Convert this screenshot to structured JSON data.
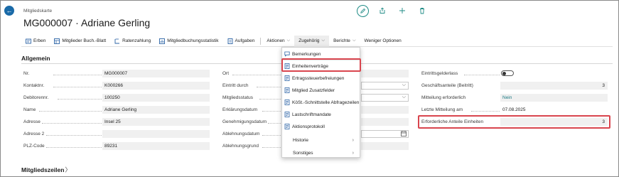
{
  "header": {
    "caption": "Mitgliedskarte",
    "title": "MG000007 · Adriane Gerling"
  },
  "toolbar": {
    "items": [
      {
        "label": "Erben"
      },
      {
        "label": "Mitglieder Buch.-Blatt"
      },
      {
        "label": "Ratenzahlung"
      },
      {
        "label": "Mitgliedbuchungsstatistik"
      },
      {
        "label": "Aufgaben"
      },
      {
        "label": "Aktionen"
      },
      {
        "label": "Zugehörig"
      },
      {
        "label": "Berichte"
      },
      {
        "label": "Weniger Optionen"
      }
    ]
  },
  "general": {
    "title": "Allgemein",
    "col1": [
      {
        "label": "Nr.",
        "value": "MG000007"
      },
      {
        "label": "Kontaktnr.",
        "value": "K000266"
      },
      {
        "label": "Debitorennr.",
        "value": "100250"
      },
      {
        "label": "Name",
        "value": "Adriane Gerling"
      },
      {
        "label": "Adresse",
        "value": "Insel 25"
      },
      {
        "label": "Adresse 2",
        "value": ""
      },
      {
        "label": "PLZ-Code",
        "value": "89231"
      }
    ],
    "col2": [
      {
        "label": "Ort",
        "value": ""
      },
      {
        "label": "Eintritt durch",
        "value": ""
      },
      {
        "label": "Mitgliedsstatus",
        "value": ""
      },
      {
        "label": "Erklärungsdatum",
        "value": ""
      },
      {
        "label": "Genehmigungsdatum",
        "value": ""
      },
      {
        "label": "Ablehnungsdatum",
        "value": ""
      },
      {
        "label": "Ablehnungsgrund",
        "value": ""
      }
    ],
    "col3": [
      {
        "label": "Eintrittsgelderlass",
        "value": ""
      },
      {
        "label": "Geschäftsanteile (Beitritt)",
        "value": "3"
      },
      {
        "label": "Mitteilung erforderlich",
        "value": "Nein"
      },
      {
        "label": "Letzte Mitteilung am",
        "value": "07.08.2025"
      },
      {
        "label": "Erforderliche Anteile Einheiten",
        "value": "3"
      }
    ]
  },
  "dropdown": {
    "items": [
      {
        "label": "Bemerkungen",
        "icon": "comment-icon"
      },
      {
        "label": "Einheitenverträge",
        "icon": "document-icon"
      },
      {
        "label": "Ertragssteuerbefreiungen",
        "icon": "document-icon"
      },
      {
        "label": "Mitglied Zusatzfelder",
        "icon": "document-icon"
      },
      {
        "label": "KöSt.-Schnittstelle Abfragezeilen",
        "icon": "document-icon"
      },
      {
        "label": "Lastschriftmandate",
        "icon": "document-icon"
      },
      {
        "label": "Aktionsprotokoll",
        "icon": "document-icon"
      },
      {
        "label": "Historie",
        "icon": ""
      },
      {
        "label": "Sonstiges",
        "icon": ""
      }
    ]
  },
  "lines": {
    "title": "Mitgliedszeilen",
    "chevron": "〉"
  },
  "colors": {
    "accent": "#1e8b85",
    "highlight": "#d9454e",
    "back_button": "#1a6aa8"
  }
}
